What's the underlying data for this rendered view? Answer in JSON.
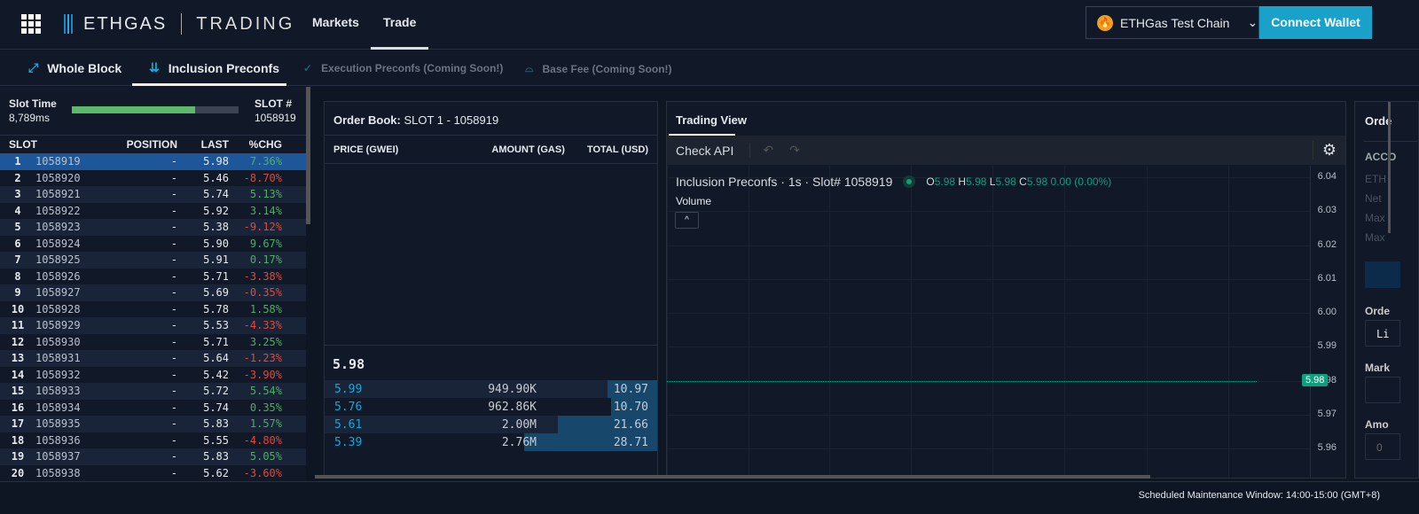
{
  "header": {
    "brand": "ETHGAS",
    "product": "TRADING",
    "nav": [
      "Markets",
      "Trade"
    ],
    "active_nav": "Trade",
    "chain": "ETHGas Test Chain",
    "connect": "Connect Wallet"
  },
  "subnav": [
    {
      "label": "Whole Block",
      "icon": "diagonal-arrow-icon",
      "disabled": false
    },
    {
      "label": "Inclusion Preconfs",
      "icon": "double-down-arrow-icon",
      "disabled": false
    },
    {
      "label": "Execution Preconfs (Coming Soon!)",
      "icon": "check-icon",
      "disabled": true
    },
    {
      "label": "Base Fee (Coming Soon!)",
      "icon": "dome-icon",
      "disabled": true
    }
  ],
  "slot_info": {
    "time_label": "Slot Time",
    "time_value": "8,789ms",
    "slot_label": "SLOT #",
    "slot_value": "1058919",
    "progress": 0.74
  },
  "slots": {
    "headers": [
      "SLOT",
      "POSITION",
      "LAST",
      "%CHG"
    ],
    "rows": [
      [
        "1",
        "1058919",
        "-",
        "5.98",
        "7.36%"
      ],
      [
        "2",
        "1058920",
        "-",
        "5.46",
        "-8.70%"
      ],
      [
        "3",
        "1058921",
        "-",
        "5.74",
        "5.13%"
      ],
      [
        "4",
        "1058922",
        "-",
        "5.92",
        "3.14%"
      ],
      [
        "5",
        "1058923",
        "-",
        "5.38",
        "-9.12%"
      ],
      [
        "6",
        "1058924",
        "-",
        "5.90",
        "9.67%"
      ],
      [
        "7",
        "1058925",
        "-",
        "5.91",
        "0.17%"
      ],
      [
        "8",
        "1058926",
        "-",
        "5.71",
        "-3.38%"
      ],
      [
        "9",
        "1058927",
        "-",
        "5.69",
        "-0.35%"
      ],
      [
        "10",
        "1058928",
        "-",
        "5.78",
        "1.58%"
      ],
      [
        "11",
        "1058929",
        "-",
        "5.53",
        "-4.33%"
      ],
      [
        "12",
        "1058930",
        "-",
        "5.71",
        "3.25%"
      ],
      [
        "13",
        "1058931",
        "-",
        "5.64",
        "-1.23%"
      ],
      [
        "14",
        "1058932",
        "-",
        "5.42",
        "-3.90%"
      ],
      [
        "15",
        "1058933",
        "-",
        "5.72",
        "5.54%"
      ],
      [
        "16",
        "1058934",
        "-",
        "5.74",
        "0.35%"
      ],
      [
        "17",
        "1058935",
        "-",
        "5.83",
        "1.57%"
      ],
      [
        "18",
        "1058936",
        "-",
        "5.55",
        "-4.80%"
      ],
      [
        "19",
        "1058937",
        "-",
        "5.83",
        "5.05%"
      ],
      [
        "20",
        "1058938",
        "-",
        "5.62",
        "-3.60%"
      ]
    ]
  },
  "orderbook": {
    "title_label": "Order Book:",
    "title_value": "SLOT 1 - 1058919",
    "headers": [
      "PRICE (GWEI)",
      "AMOUNT (GAS)",
      "TOTAL (USD)"
    ],
    "last": "5.98",
    "rows": [
      {
        "price": "5.99",
        "amount": "949.90K",
        "total": "10.97",
        "depth": 0.15
      },
      {
        "price": "5.76",
        "amount": "962.86K",
        "total": "10.70",
        "depth": 0.14
      },
      {
        "price": "5.61",
        "amount": "2.00M",
        "total": "21.66",
        "depth": 0.3
      },
      {
        "price": "5.39",
        "amount": "2.76M",
        "total": "28.71",
        "depth": 0.4
      }
    ]
  },
  "tradingview": {
    "tab": "Trading View",
    "check_api": "Check API",
    "symbol": "Inclusion Preconfs · 1s · Slot# 1058919",
    "ohlc": {
      "O": "5.98",
      "H": "5.98",
      "L": "5.98",
      "C": "5.98",
      "change": "0.00 (0.00%)"
    },
    "volume": "Volume",
    "y_ticks": [
      "6.04",
      "6.03",
      "6.02",
      "6.01",
      "6.00",
      "5.99",
      "5.98",
      "5.97",
      "5.96"
    ],
    "price_label": "5.98",
    "accent": "#0d9f7e"
  },
  "right_panel": {
    "title": "Orde",
    "acct": "ACCO",
    "lines": [
      "ETH",
      "Net",
      "Max",
      "Max"
    ],
    "order": "Orde",
    "order_val": "Li",
    "mark": "Mark",
    "amount": "Amo",
    "amount_val": "0"
  },
  "footer": {
    "text": "Scheduled Maintenance Window: 14:00-15:00 (GMT+8)"
  }
}
